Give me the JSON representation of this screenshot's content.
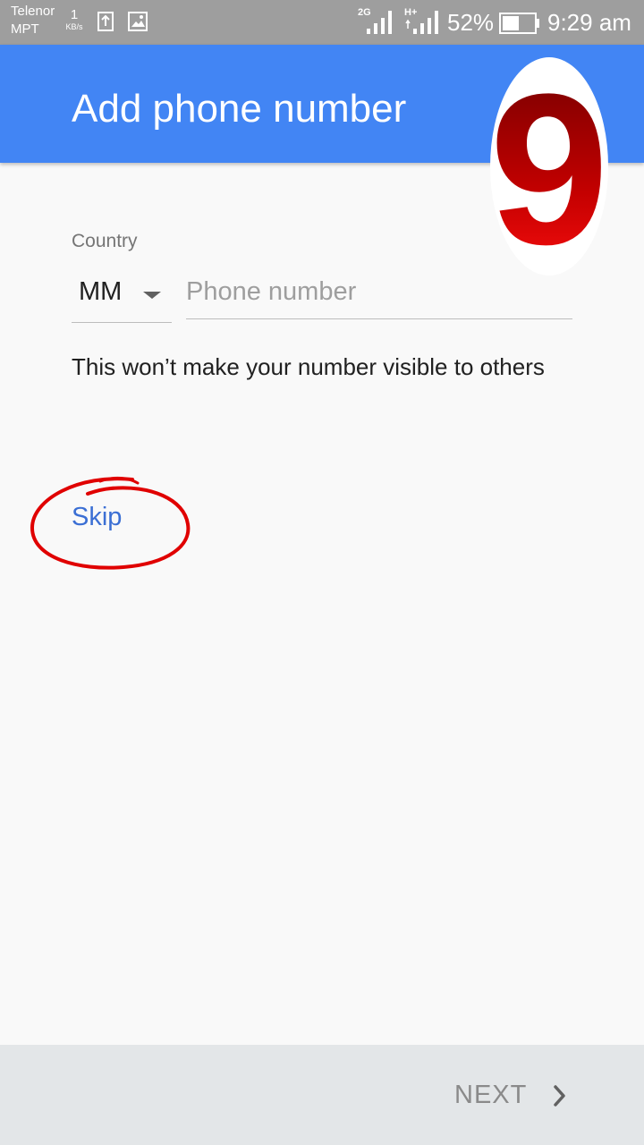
{
  "status_bar": {
    "carrier_line1": "Telenor",
    "carrier_line2": "MPT",
    "net_speed_value": "1",
    "net_speed_unit": "KB/s",
    "sim1_type": "2G",
    "sim2_type": "H+",
    "battery_percent": "52%",
    "battery_level": 0.52,
    "time": "9:29 am"
  },
  "header": {
    "title": "Add phone number",
    "badge_number": "9"
  },
  "form": {
    "country_label": "Country",
    "country_value": "MM",
    "phone_placeholder": "Phone number",
    "phone_value": "",
    "hint": "This won’t make your number visible to others",
    "skip_label": "Skip"
  },
  "footer": {
    "next_label": "NEXT"
  },
  "colors": {
    "app_bar": "#4285f4",
    "status_bar": "#9e9e9e",
    "link": "#3b6fd4",
    "annotation_red": "#e00000"
  }
}
